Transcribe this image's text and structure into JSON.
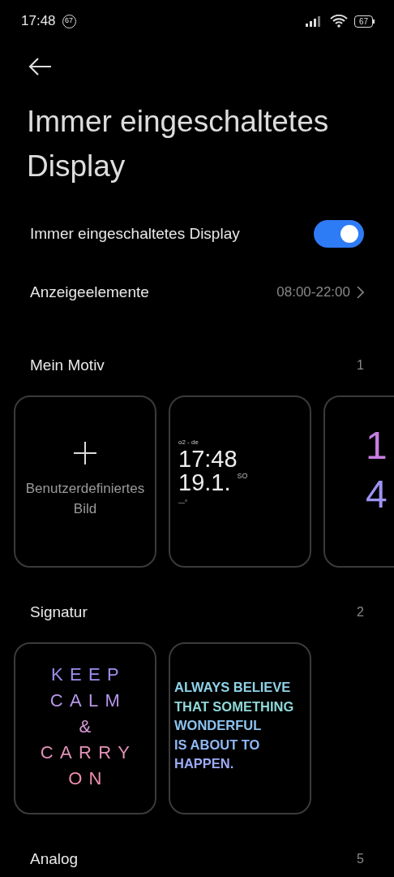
{
  "status_bar": {
    "time": "17:48",
    "notification_badge": "67",
    "battery": "67"
  },
  "title": "Immer eingeschaltetes Display",
  "settings": [
    {
      "kind": "toggle",
      "label": "Immer eingeschaltetes Display",
      "on": true
    },
    {
      "kind": "link",
      "label": "Anzeigeelemente",
      "value": "08:00-22:00"
    }
  ],
  "sections": [
    {
      "title": "Mein Motiv",
      "count": "1",
      "cards": [
        {
          "kind": "add",
          "label": "Benutzerdefiniertes Bild"
        },
        {
          "kind": "clock",
          "date_line": "o2 - de",
          "time": "17:48",
          "date": "19.1.",
          "weekday": "SO",
          "temperature": "—°"
        },
        {
          "kind": "digits",
          "lines": [
            {
              "text": "1",
              "color": "#c77ee0"
            },
            {
              "text": "4",
              "color": "#9d93f2"
            }
          ]
        }
      ]
    },
    {
      "title": "Signatur",
      "count": "2",
      "cards": [
        {
          "kind": "spaced",
          "lines": [
            {
              "text": "KEEP",
              "color": "#a08ef0"
            },
            {
              "text": "CALM",
              "color": "#b796e8"
            },
            {
              "text": "&",
              "color": "#d99ad8"
            },
            {
              "text": "CARRY",
              "color": "#e592b8"
            },
            {
              "text": "ON",
              "color": "#ec8fae"
            }
          ]
        },
        {
          "kind": "bold",
          "lines": [
            {
              "text": "ALWAYS BELIEVE",
              "color": "#8fd3e8"
            },
            {
              "text": "THAT SOMETHING",
              "color": "#8fd8d8"
            },
            {
              "text": "WONDERFUL",
              "color": "#8cc4f0"
            },
            {
              "text": "IS ABOUT TO",
              "color": "#8fb8f5"
            },
            {
              "text": "HAPPEN.",
              "color": "#9caaf5"
            }
          ]
        }
      ]
    },
    {
      "title": "Analog",
      "count": "5"
    }
  ]
}
